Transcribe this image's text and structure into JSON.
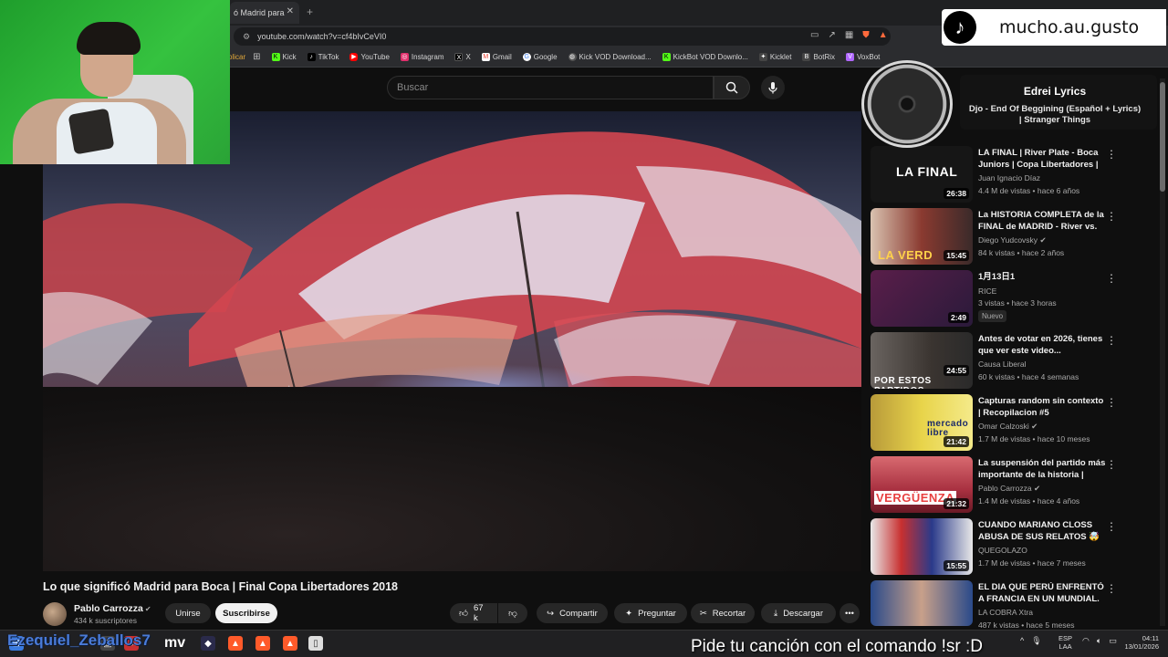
{
  "browser": {
    "tab_title": "ó Madrid para",
    "url": "youtube.com/watch?v=cf4bIvCeVI0",
    "bookmarks": [
      {
        "label": "plicar",
        "icon": "bookmark-icon",
        "color": "#e0a73a"
      },
      {
        "label": "Kick",
        "icon": "kick-icon",
        "color": "#53fc18"
      },
      {
        "label": "TikTok",
        "icon": "tiktok-icon",
        "color": "#ffffff"
      },
      {
        "label": "YouTube",
        "icon": "youtube-icon",
        "color": "#ff0000"
      },
      {
        "label": "Instagram",
        "icon": "instagram-icon",
        "color": "#e1306c"
      },
      {
        "label": "X",
        "icon": "x-icon",
        "color": "#ffffff"
      },
      {
        "label": "Gmail",
        "icon": "gmail-icon",
        "color": "#ea4335"
      },
      {
        "label": "Google",
        "icon": "google-icon",
        "color": "#4285f4"
      },
      {
        "label": "Kick VOD Download...",
        "icon": "globe-icon",
        "color": "#9aa0a6"
      },
      {
        "label": "KickBot VOD Downlo...",
        "icon": "kickbot-icon",
        "color": "#53fc18"
      },
      {
        "label": "Kicklet",
        "icon": "kicklet-icon",
        "color": "#9aa0a6"
      },
      {
        "label": "BotRix",
        "icon": "botrix-icon",
        "color": "#9aa0a6"
      },
      {
        "label": "VoxBot",
        "icon": "voxbot-icon",
        "color": "#b067ff"
      }
    ]
  },
  "youtube": {
    "search_placeholder": "Buscar",
    "video_title": "Lo que significó Madrid para Boca | Final Copa Libertadores 2018",
    "channel": {
      "name": "Pablo Carrozza",
      "subscribers": "434 k suscriptores"
    },
    "buttons": {
      "join": "Unirse",
      "subscribe": "Suscribirse",
      "likes": "67 k",
      "share": "Compartir",
      "ask": "Preguntar",
      "clip": "Recortar",
      "download": "Descargar"
    },
    "recommendations": [
      {
        "title": "LA FINAL | River Plate - Boca Juniors | Copa Libertadores | L...",
        "channel": "Juan Ignacio Díaz",
        "verified": false,
        "meta": "4.4 M de vistas • hace 6 años",
        "duration": "26:38",
        "thumb_text": "LA FINAL",
        "thumb_color": "#1b1b1b"
      },
      {
        "title": "La HISTORIA COMPLETA de la FINAL de MADRID - River vs. ...",
        "channel": "Diego Yudcovsky",
        "verified": true,
        "meta": "84 k vistas • hace 2 años",
        "duration": "15:45",
        "thumb_text": "LA VERD",
        "thumb_color": "#7a2a22"
      },
      {
        "title": "1月13日1",
        "channel": "RICE",
        "verified": false,
        "meta": "3 vistas • hace 3 horas",
        "duration": "2:49",
        "badge": "Nuevo",
        "thumb_text": "",
        "thumb_color": "#4a1e40"
      },
      {
        "title": "Antes de votar en 2026, tienes que ver este video...",
        "channel": "Causa Liberal",
        "verified": false,
        "meta": "60 k vistas • hace 4 semanas",
        "duration": "24:55",
        "thumb_text": "POR ESTOS PARTIDOS",
        "thumb_color": "#3a3430"
      },
      {
        "title": "Capturas random sin contexto | Recopilacion #5",
        "channel": "Omar Calzoski",
        "verified": true,
        "meta": "1.7 M de vistas • hace 10 meses",
        "duration": "21:42",
        "thumb_text": "mercado libre",
        "thumb_color": "#e8d44a"
      },
      {
        "title": "La suspensión del partido más importante de la historia | Rive...",
        "channel": "Pablo Carrozza",
        "verified": true,
        "meta": "1.4 M de vistas • hace 4 años",
        "duration": "21:32",
        "thumb_text": "VERGÜENZA",
        "thumb_color": "#8a2430"
      },
      {
        "title": "CUANDO MARIANO CLOSS ABUSA DE SUS RELATOS 🤯",
        "channel": "QUEGOLAZO",
        "verified": false,
        "meta": "1.7 M de vistas • hace 7 meses",
        "duration": "15:55",
        "thumb_text": "",
        "thumb_color": "#c8c8c8"
      },
      {
        "title": "EL DIA QUE PERÚ ENFRENTÓ A FRANCIA EN UN MUNDIAL. ...",
        "channel": "LA COBRA Xtra",
        "verified": false,
        "meta": "487 k vistas • hace 5 meses",
        "duration": "",
        "thumb_text": "",
        "thumb_color": "#2a4a8a"
      }
    ]
  },
  "now_playing": {
    "tiktok_handle": "mucho.au.gusto",
    "artist": "Edrei Lyrics",
    "song": "Djo - End Of Beggining (Español + Lyrics) | Stranger Things"
  },
  "stream_overlay": {
    "username": "Ezequiel_Zeballos7",
    "bot_message": "Pide tu canción con el comando !sr :D",
    "taskbar_label": "mv"
  },
  "system": {
    "language": "ESP",
    "layout": "LAA",
    "time": "04:11",
    "date": "13/01/2026"
  }
}
